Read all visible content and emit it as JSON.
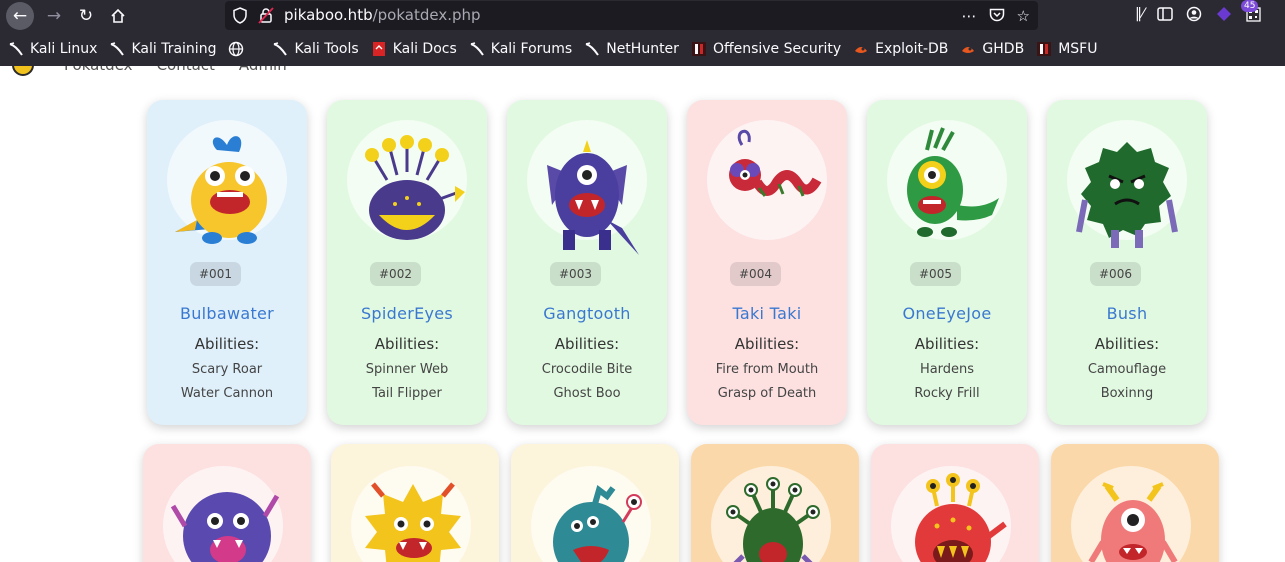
{
  "browser": {
    "url_host": "pikaboo.htb",
    "url_path": "/pokatdex.php",
    "extension_badge": "45",
    "bookmarks": [
      {
        "label": "Kali Linux",
        "icon": "kali-dragon-icon"
      },
      {
        "label": "Kali Training",
        "icon": "kali-dragon-icon"
      },
      {
        "label": "",
        "icon": "globe-icon"
      },
      {
        "label": "Kali Tools",
        "icon": "kali-dragon-icon"
      },
      {
        "label": "Kali Docs",
        "icon": "kali-docs-icon"
      },
      {
        "label": "Kali Forums",
        "icon": "kali-dragon-icon"
      },
      {
        "label": "NetHunter",
        "icon": "kali-dragon-icon"
      },
      {
        "label": "Offensive Security",
        "icon": "offsec-icon"
      },
      {
        "label": "Exploit-DB",
        "icon": "exploitdb-icon"
      },
      {
        "label": "GHDB",
        "icon": "exploitdb-icon"
      },
      {
        "label": "MSFU",
        "icon": "offsec-icon"
      }
    ]
  },
  "site": {
    "nav": [
      "Pokatdex",
      "Contact",
      "Admin"
    ]
  },
  "colors": {
    "blue": "#dff0fb",
    "green": "#e1f9e1",
    "pink": "#fde1e1",
    "cream": "#fdf4dc",
    "orange": "#fbd8a9"
  },
  "monsters": [
    {
      "num": "#001",
      "name": "Bulbawater",
      "abilities_title": "Abilities:",
      "abilities": [
        "Scary Roar",
        "Water Cannon"
      ],
      "bg": "blue"
    },
    {
      "num": "#002",
      "name": "SpiderEyes",
      "abilities_title": "Abilities:",
      "abilities": [
        "Spinner Web",
        "Tail Flipper"
      ],
      "bg": "green"
    },
    {
      "num": "#003",
      "name": "Gangtooth",
      "abilities_title": "Abilities:",
      "abilities": [
        "Crocodile Bite",
        "Ghost Boo"
      ],
      "bg": "green"
    },
    {
      "num": "#004",
      "name": "Taki Taki",
      "abilities_title": "Abilities:",
      "abilities": [
        "Fire from Mouth",
        "Grasp of Death"
      ],
      "bg": "pink"
    },
    {
      "num": "#005",
      "name": "OneEyeJoe",
      "abilities_title": "Abilities:",
      "abilities": [
        "Hardens",
        "Rocky Frill"
      ],
      "bg": "green"
    },
    {
      "num": "#006",
      "name": "Bush",
      "abilities_title": "Abilities:",
      "abilities": [
        "Camouflage",
        "Boxinng"
      ],
      "bg": "green"
    }
  ],
  "second_row": [
    {
      "bg": "pink",
      "icon": "purple-furry-monster-icon"
    },
    {
      "bg": "cream",
      "icon": "yellow-spiky-monster-icon"
    },
    {
      "bg": "cream",
      "icon": "teal-monster-icon"
    },
    {
      "bg": "orange",
      "icon": "green-tentacle-monster-icon"
    },
    {
      "bg": "pink",
      "icon": "red-three-eyed-monster-icon"
    },
    {
      "bg": "orange",
      "icon": "pink-cyclops-monster-icon"
    }
  ]
}
